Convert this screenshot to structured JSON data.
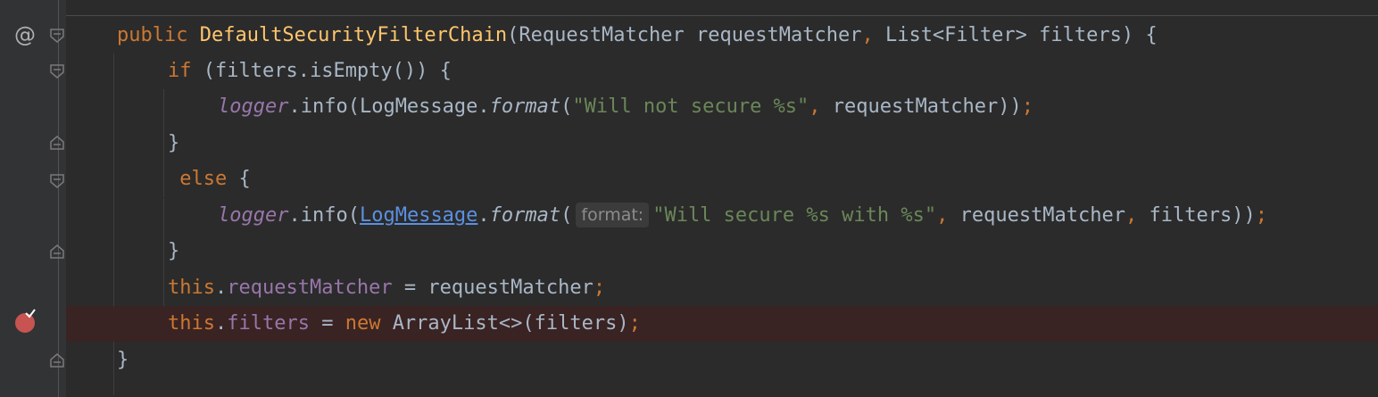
{
  "editor": {
    "lines": [
      {
        "tokens": [
          {
            "t": "public ",
            "c": "kw"
          },
          {
            "t": "DefaultSecurityFilterChain",
            "c": "fn"
          },
          {
            "t": "(RequestMatcher requestMatcher",
            "c": ""
          },
          {
            "t": ", ",
            "c": "kw"
          },
          {
            "t": "List<Filter> filters) {",
            "c": ""
          }
        ]
      },
      {
        "tokens": [
          {
            "t": "if ",
            "c": "kw"
          },
          {
            "t": "(filters.isEmpty()) {",
            "c": ""
          }
        ]
      },
      {
        "tokens": [
          {
            "t": "logger",
            "c": "static-fld"
          },
          {
            "t": ".info(LogMessage.",
            "c": ""
          },
          {
            "t": "format",
            "c": "ital"
          },
          {
            "t": "(",
            "c": ""
          },
          {
            "t": "\"Will not secure %s\"",
            "c": "str"
          },
          {
            "t": ", ",
            "c": "kw"
          },
          {
            "t": "requestMatcher))",
            "c": ""
          },
          {
            "t": ";",
            "c": "kw"
          }
        ]
      },
      {
        "tokens": [
          {
            "t": "}",
            "c": ""
          }
        ]
      },
      {
        "tokens": [
          {
            "t": " else ",
            "c": "kw"
          },
          {
            "t": "{",
            "c": ""
          }
        ]
      },
      {
        "tokens": [
          {
            "t": "logger",
            "c": "static-fld"
          },
          {
            "t": ".info(",
            "c": ""
          },
          {
            "t": "LogMessage",
            "c": "link"
          },
          {
            "t": ".",
            "c": ""
          },
          {
            "t": "format",
            "c": "ital"
          },
          {
            "t": "(",
            "c": ""
          },
          {
            "t": "format:",
            "c": "hint"
          },
          {
            "t": "\"Will secure %s with %s\"",
            "c": "str"
          },
          {
            "t": ", ",
            "c": "kw"
          },
          {
            "t": "requestMatcher",
            "c": ""
          },
          {
            "t": ", ",
            "c": "kw"
          },
          {
            "t": "filters))",
            "c": ""
          },
          {
            "t": ";",
            "c": "kw"
          }
        ]
      },
      {
        "tokens": [
          {
            "t": "}",
            "c": ""
          }
        ]
      },
      {
        "tokens": [
          {
            "t": "this",
            "c": "kw"
          },
          {
            "t": ".",
            "c": ""
          },
          {
            "t": "requestMatcher",
            "c": "fld"
          },
          {
            "t": " = requestMatcher",
            "c": ""
          },
          {
            "t": ";",
            "c": "kw"
          }
        ]
      },
      {
        "tokens": [
          {
            "t": "this",
            "c": "kw"
          },
          {
            "t": ".",
            "c": ""
          },
          {
            "t": "filters",
            "c": "fld"
          },
          {
            "t": " = ",
            "c": ""
          },
          {
            "t": "new ",
            "c": "kw"
          },
          {
            "t": "ArrayList<>(filters)",
            "c": ""
          },
          {
            "t": ";",
            "c": "kw"
          }
        ]
      },
      {
        "tokens": [
          {
            "t": "}",
            "c": ""
          }
        ]
      }
    ]
  },
  "gutter": {
    "annotation_symbol": "@",
    "breakpoint": "breakpoint-verified-icon"
  },
  "colors": {
    "background": "#2b2b2b",
    "gutter": "#313335",
    "breakpoint_line": "#3a2323",
    "breakpoint": "#c75450"
  }
}
